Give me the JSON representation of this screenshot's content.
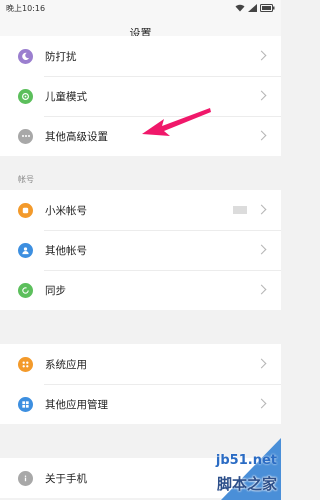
{
  "status_bar": {
    "time": "晚上10:16"
  },
  "header": {
    "title": "设置"
  },
  "groups": {
    "first": [
      {
        "label": "防打扰",
        "icon": "moon-icon",
        "color": "#9b7fcf"
      },
      {
        "label": "儿童模式",
        "icon": "child-mode-icon",
        "color": "#5cbf5c"
      },
      {
        "label": "其他高级设置",
        "icon": "more-dots-icon",
        "color": "#a8a8a8"
      }
    ],
    "account_header": "帐号",
    "account": [
      {
        "label": "小米帐号",
        "icon": "mi-account-icon",
        "color": "#f39a2b"
      },
      {
        "label": "其他帐号",
        "icon": "user-icon",
        "color": "#3d8fe0"
      },
      {
        "label": "同步",
        "icon": "sync-icon",
        "color": "#5cbf5c"
      }
    ],
    "apps": [
      {
        "label": "系统应用",
        "icon": "grid-icon",
        "color": "#f39a2b"
      },
      {
        "label": "其他应用管理",
        "icon": "apps-icon",
        "color": "#3d8fe0"
      }
    ],
    "about": [
      {
        "label": "关于手机",
        "icon": "info-icon",
        "color": "#a8a8a8"
      }
    ]
  },
  "annotation": {
    "arrow_color": "#f0186a"
  },
  "watermark": {
    "site": "jb51.net",
    "name": "脚本之家"
  }
}
